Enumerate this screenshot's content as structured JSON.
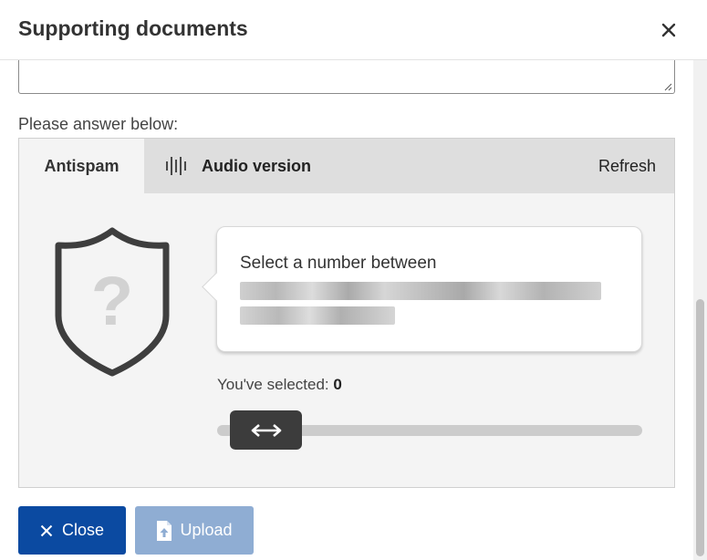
{
  "dialog": {
    "title": "Supporting documents"
  },
  "form": {
    "prompt": "Please answer below:"
  },
  "captcha": {
    "tabs": {
      "antispam": "Antispam",
      "audio": "Audio version"
    },
    "refresh": "Refresh",
    "question": "Select a number between",
    "selected_label": "You've selected: ",
    "selected_value": "0",
    "colors": {
      "tabbar": "#dedede",
      "panel": "#f4f4f4",
      "handle": "#3c3c3c"
    }
  },
  "footer": {
    "close_label": "Close",
    "upload_label": "Upload",
    "colors": {
      "close_bg": "#0b4aa1",
      "upload_bg": "#8fadd3"
    }
  },
  "icons": {
    "close": "close-icon",
    "audio": "audio-waveform-icon",
    "shield": "shield-question-icon",
    "arrows": "horizontal-arrows-icon",
    "upload": "file-upload-icon"
  }
}
